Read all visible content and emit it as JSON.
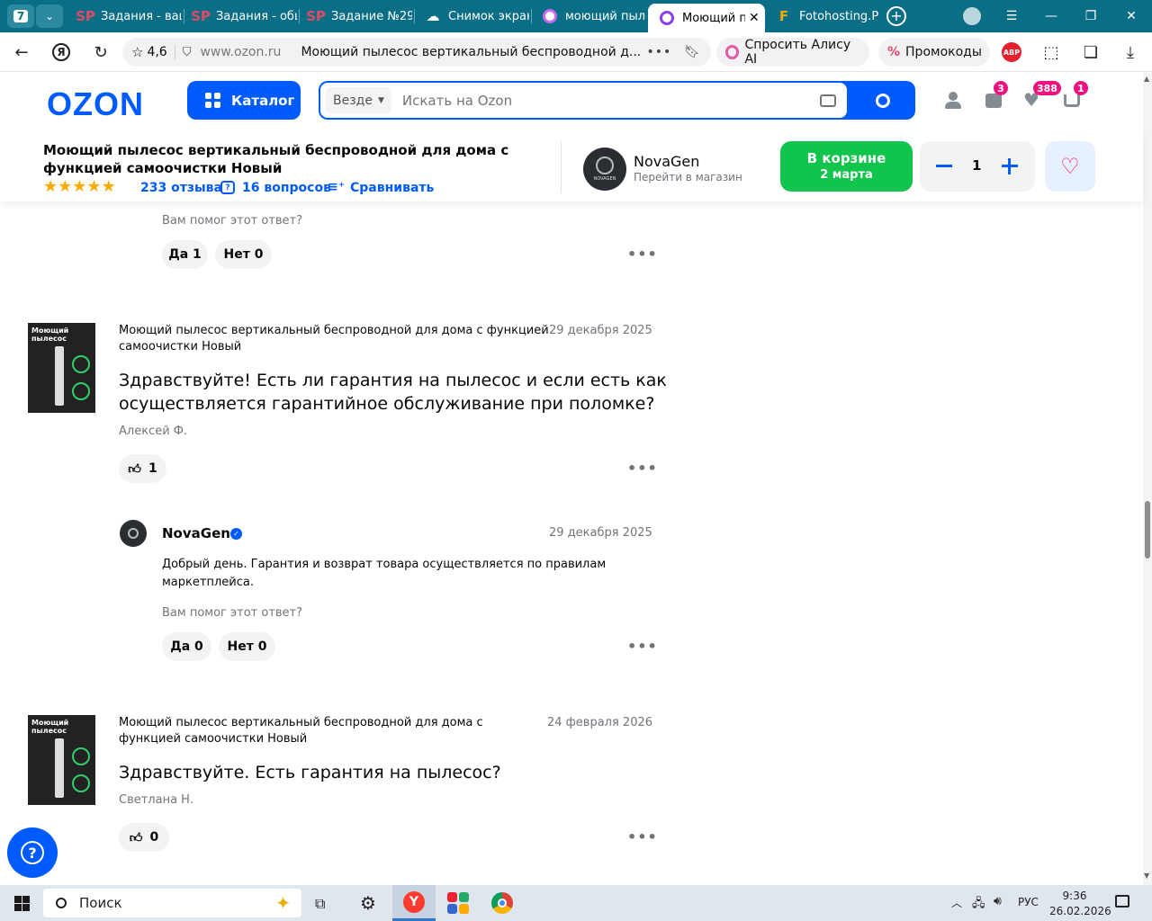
{
  "browser": {
    "tab_counter": "7",
    "tabs": [
      {
        "label": "Задания - ваш",
        "icon": "SP"
      },
      {
        "label": "Задания - общ",
        "icon": "SP"
      },
      {
        "label": "Задание №29",
        "icon": "SP"
      },
      {
        "label": "Снимок экрана",
        "icon": "cloud"
      },
      {
        "label": "моющий пыле",
        "icon": "alice"
      },
      {
        "label": "Моющий пы",
        "icon": "alice"
      },
      {
        "label": "Fotohosting.P",
        "icon": "F"
      }
    ],
    "rating": "4,6",
    "url_host": "www.ozon.ru",
    "page_title": "Моющий пылесос вертикальный беспроводной д...",
    "alice_label": "Спросить Алису AI",
    "promo_label": "Промокоды",
    "abp_label": "ABP"
  },
  "ozon": {
    "logo": "OZON",
    "catalog_label": "Каталог",
    "search_scope": "Везде",
    "search_placeholder": "Искать на Ozon",
    "badges": {
      "orders": "3",
      "favorites": "388",
      "cart": "1"
    }
  },
  "product": {
    "title_line1": "Моющий пылесос вертикальный беспроводной для дома с",
    "title_line2": "функцией самоочистки Новый",
    "reviews": "233 отзыва",
    "questions": "16 вопросов",
    "compare": "Сравнивать",
    "rating_stars": 5,
    "seller_name": "NovaGen",
    "seller_link": "Перейти в магазин",
    "seller_avatar_text": "NOVAGEN",
    "cart_label": "В корзине",
    "cart_date": "2 марта",
    "quantity": "1"
  },
  "top_feedback": {
    "prompt": "Вам помог этот ответ?",
    "yes": "Да 1",
    "no": "Нет 0"
  },
  "questions": [
    {
      "product_line1": "Моющий пылесос вертикальный беспроводной для дома с функцией",
      "product_line2": "самоочистки Новый",
      "date": "29 декабря 2025",
      "text_line1": "Здравствуйте! Есть ли гарантия на пылесос и если есть как",
      "text_line2": "осуществляется гарантийное обслуживание при поломке?",
      "author": "Алексей Ф.",
      "likes": "1",
      "thumb_title": "Моющий пылесос",
      "answer": {
        "seller": "NovaGen",
        "date": "29 декабря 2025",
        "text_line1": "Добрый день. Гарантия и возврат товара осуществляется по правилам",
        "text_line2": "маркетплейса.",
        "prompt": "Вам помог этот ответ?",
        "yes": "Да 0",
        "no": "Нет 0"
      }
    },
    {
      "product_line1": "Моющий пылесос вертикальный беспроводной для дома с",
      "product_line2": "функцией самоочистки Новый",
      "date": "24 февраля 2026",
      "text_line1": "Здравствуйте. Есть гарантия на пылесос?",
      "author": "Светлана Н.",
      "likes": "0",
      "thumb_title": "Моющий пылесос"
    }
  ],
  "taskbar": {
    "search_label": "Поиск",
    "lang": "РУС",
    "time": "9:36",
    "date": "26.02.2026"
  },
  "colors": {
    "ozon_blue": "#005bff",
    "cart_green": "#10c44c",
    "badge_pink": "#f1117e",
    "tab_teal": "#0a6f86"
  }
}
